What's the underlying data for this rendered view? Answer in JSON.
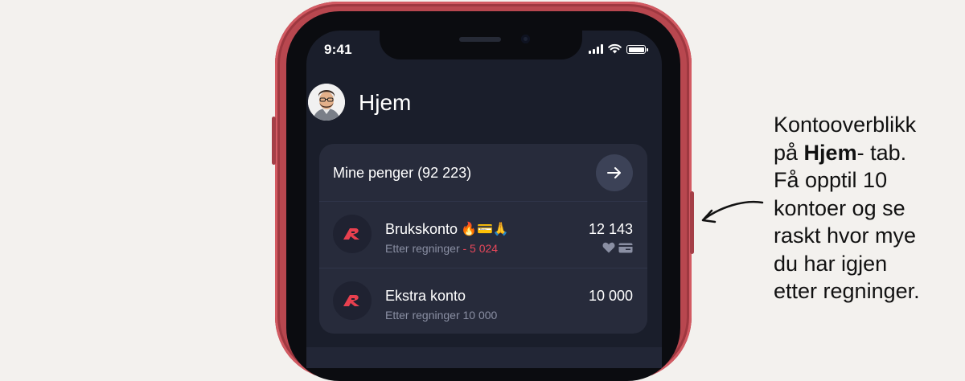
{
  "status_bar": {
    "time": "9:41"
  },
  "header": {
    "title": "Hjem"
  },
  "summary_card": {
    "title": "Mine penger (92 223)",
    "accounts": [
      {
        "name": "Brukskonto",
        "emoji": "🔥💳🙏",
        "sub_label": "Etter regninger",
        "sub_value": "- 5 024",
        "amount": "12 143",
        "icons": [
          "heart-icon",
          "card-icon"
        ]
      },
      {
        "name": "Ekstra konto",
        "emoji": "",
        "sub_label": "Etter regninger",
        "sub_value": "10 000",
        "amount": "10 000",
        "icons": []
      }
    ]
  },
  "annotation": {
    "line1": "Kontooverblikk",
    "line2_prefix": "på ",
    "line2_bold": "Hjem",
    "line2_suffix": "- tab.",
    "line3": "Få opptil 10",
    "line4": "kontoer og se",
    "line5": "raskt hvor mye",
    "line6": "du har igjen",
    "line7": "etter regninger."
  },
  "colors": {
    "background": "#f3f1ee",
    "phone_frame": "#b8474f",
    "screen": "#1a1e2b",
    "card": "#272b3b",
    "negative": "#e6475a",
    "logo": "#e8404f"
  }
}
